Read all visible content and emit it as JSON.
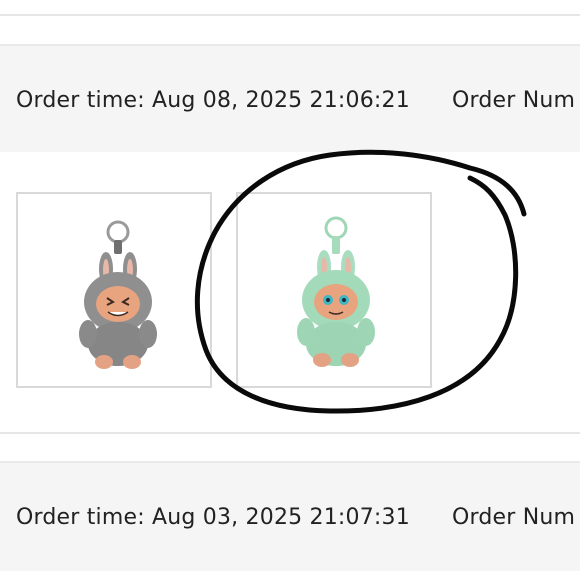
{
  "orders": [
    {
      "order_time": "Order time: Aug 08, 2025 21:06:21",
      "order_number_label": "Order Num",
      "items": [
        {
          "name": "grey-bunny-keychain",
          "color": "#8f8f8f",
          "accent": "#c8c8c8"
        },
        {
          "name": "mint-bunny-keychain",
          "color": "#9fd6b6",
          "accent": "#c9ecd8"
        }
      ]
    },
    {
      "order_time": "Order time: Aug 03, 2025 21:07:31",
      "order_number_label": "Order Num"
    }
  ],
  "annotation": {
    "type": "hand-drawn-circle",
    "color": "#000000"
  }
}
